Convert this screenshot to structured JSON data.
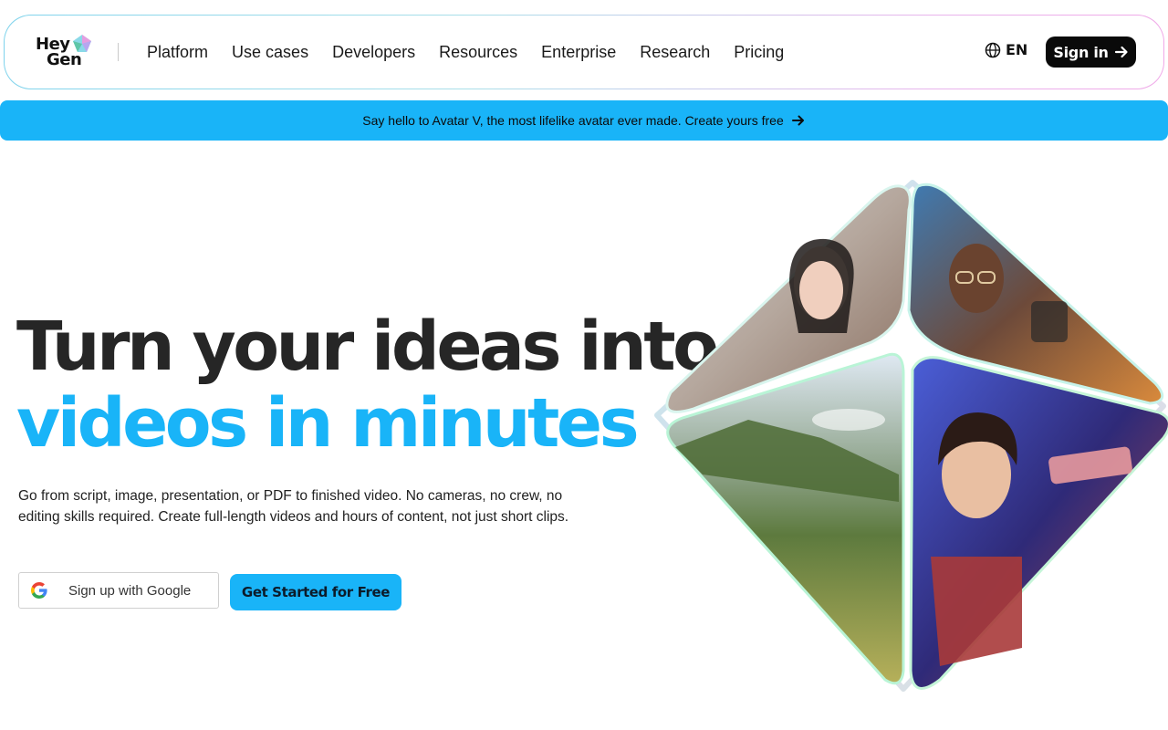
{
  "header": {
    "logo": {
      "line1": "Hey",
      "line2": "Gen"
    },
    "nav": [
      {
        "label": "Platform"
      },
      {
        "label": "Use cases"
      },
      {
        "label": "Developers"
      },
      {
        "label": "Resources"
      },
      {
        "label": "Enterprise"
      },
      {
        "label": "Research"
      },
      {
        "label": "Pricing"
      }
    ],
    "language": "EN",
    "sign_in_label": "Sign in"
  },
  "banner": {
    "text": "Say hello to Avatar V, the most lifelike avatar ever made. Create yours free"
  },
  "hero": {
    "title_line1": "Turn your ideas into",
    "title_line2": "videos in minutes",
    "description": "Go from script, image, presentation, or PDF to finished video. No cameras, no crew, no editing skills required. Create full-length videos and hours of content, not just short clips.",
    "google_button_label": "Sign up with Google",
    "cta_label": "Get Started for Free"
  },
  "colors": {
    "accent": "#19b4f8",
    "dark": "#0a0a0a",
    "title": "#262626"
  },
  "icons": [
    "logo-gem-icon",
    "globe-icon",
    "arrow-right-icon",
    "google-g-icon"
  ]
}
